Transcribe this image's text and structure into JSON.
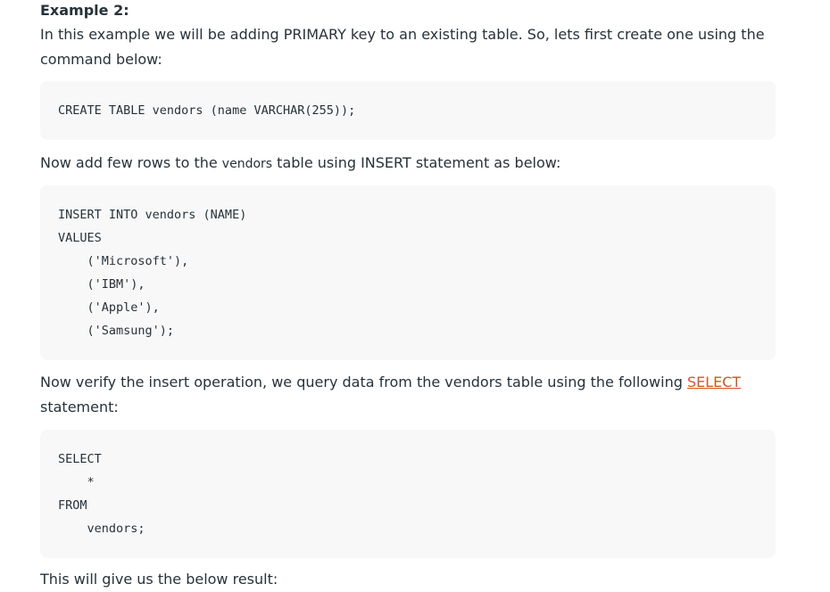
{
  "example": {
    "title": "Example 2:",
    "intro_line1": "In this example we will be adding PRIMARY key to an existing table. So, lets first create one using the",
    "intro_line2": "command below:",
    "create_code": [
      "CREATE TABLE vendors (name VARCHAR(255));"
    ],
    "insert_intro_before": "Now add few rows to the ",
    "insert_intro_code": "vendors",
    "insert_intro_after": " table using INSERT statement as below:",
    "insert_code": [
      "INSERT INTO vendors (NAME)",
      "VALUES",
      "    ('Microsoft'),",
      "    ('IBM'),",
      "    ('Apple'),",
      "    ('Samsung');"
    ],
    "verify_intro_before": "Now verify the insert operation, we query data from the vendors table using the following ",
    "verify_link": "SELECT",
    "verify_intro_line2": "statement:",
    "select_code": [
      "SELECT",
      "    *",
      "FROM",
      "    vendors;"
    ],
    "result_intro": "This will give us the below result:"
  },
  "colors": {
    "text": "#273239",
    "link": "#d9531e",
    "code_bg": "#f8f8f8"
  }
}
